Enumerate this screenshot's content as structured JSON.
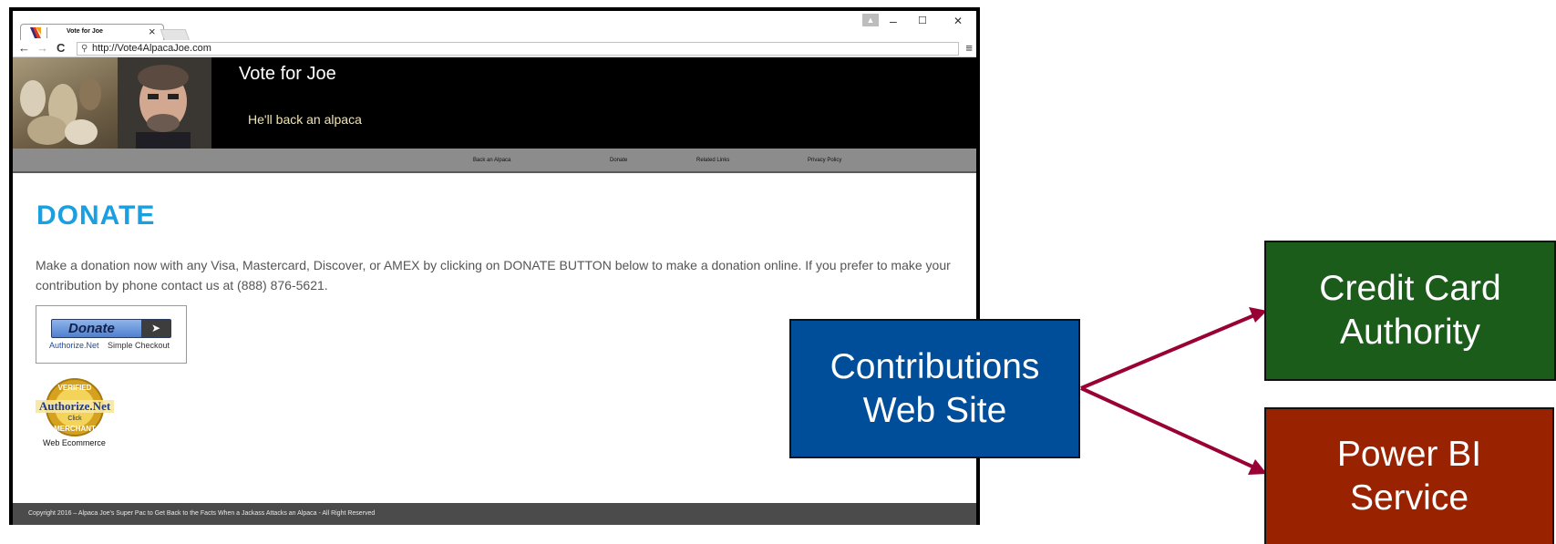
{
  "browser": {
    "tab_title": "Vote for Joe",
    "tab_close": "×",
    "url": "http://Vote4AlpacaJoe.com",
    "nav": {
      "back": "←",
      "forward": "→",
      "reload": "C",
      "menu": "≡"
    },
    "window_controls": {
      "minimize": "–",
      "maximize": "☐",
      "close": "✕"
    }
  },
  "site": {
    "title": "Vote for Joe",
    "tagline": "He'll back an alpaca",
    "nav": [
      "Back an Alpaca",
      "Donate",
      "Related Links",
      "Privacy Policy"
    ],
    "heading": "DONATE",
    "body_text": "Make a donation now with any Visa, Mastercard, Discover, or AMEX by clicking on DONATE BUTTON below to make a donation online. If you prefer to make your contribution by phone contact us at (888) 876-5621.",
    "donate_button": {
      "label": "Donate",
      "arrow": "➤",
      "brand": "Authorize.Net",
      "subtext": "Simple Checkout"
    },
    "seal": {
      "brand": "Authorize.Net",
      "top": "VERIFIED",
      "bottom": "MERCHANT",
      "click": "Click",
      "caption": "Web Ecommerce"
    },
    "footer": "Copyright 2016 – Alpaca Joe's Super Pac to Get Back to the Facts When a Jackass Attacks an Alpaca - All Right Reserved"
  },
  "diagram": {
    "source": {
      "line1": "Contributions",
      "line2": "Web Site",
      "color": "#004d99"
    },
    "targets": [
      {
        "line1": "Credit Card",
        "line2": "Authority",
        "color": "#1b5c1b"
      },
      {
        "line1": "Power BI",
        "line2": "Service",
        "color": "#992200"
      }
    ],
    "arrow_color": "#990033"
  }
}
